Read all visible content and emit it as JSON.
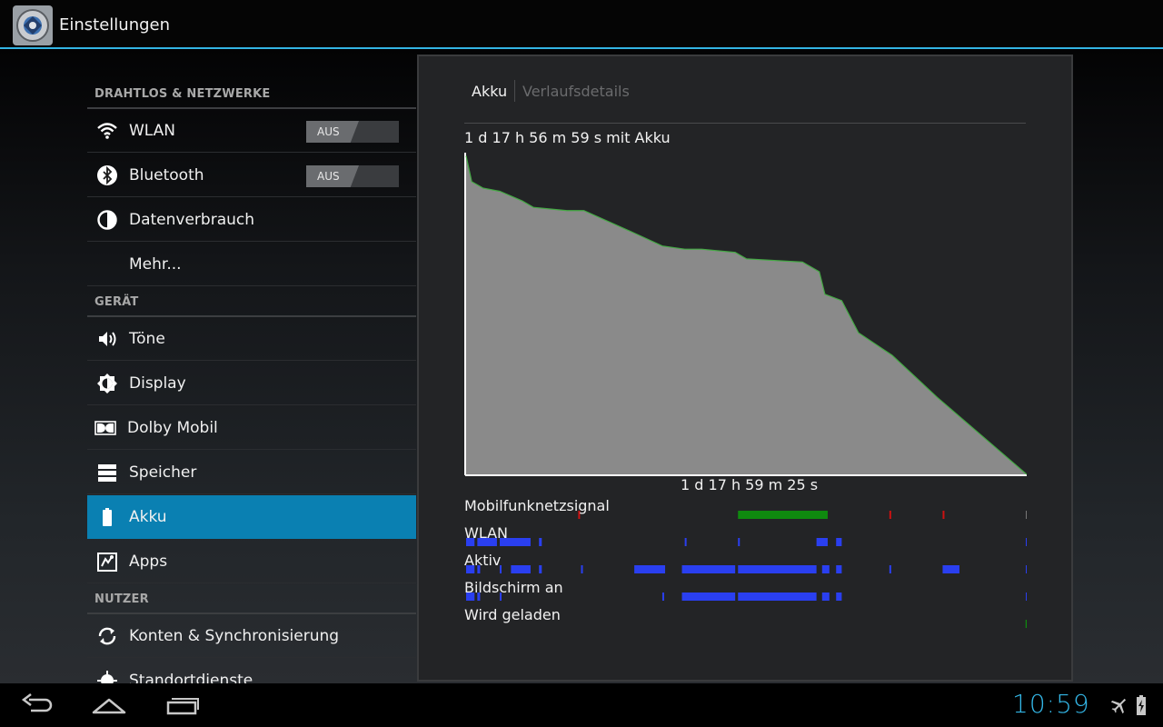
{
  "app": {
    "title": "Einstellungen",
    "icon": "settings-gear-icon"
  },
  "sidebar": {
    "categories": {
      "wireless": "DRAHTLOS & NETZWERKE",
      "device": "GERÄT",
      "users": "NUTZER"
    },
    "items": {
      "wlan": {
        "label": "WLAN",
        "icon": "wifi-icon",
        "toggle": "AUS"
      },
      "bluetooth": {
        "label": "Bluetooth",
        "icon": "bluetooth-icon",
        "toggle": "AUS"
      },
      "data_usage": {
        "label": "Datenverbrauch",
        "icon": "data-usage-icon"
      },
      "more": {
        "label": "Mehr..."
      },
      "sound": {
        "label": "Töne",
        "icon": "speaker-icon"
      },
      "display": {
        "label": "Display",
        "icon": "brightness-icon"
      },
      "dolby": {
        "label": "Dolby Mobil",
        "icon": "dolby-icon"
      },
      "storage": {
        "label": "Speicher",
        "icon": "storage-icon"
      },
      "battery": {
        "label": "Akku",
        "icon": "battery-icon",
        "selected": true
      },
      "apps": {
        "label": "Apps",
        "icon": "apps-icon"
      },
      "accounts": {
        "label": "Konten & Synchronisierung",
        "icon": "sync-icon"
      },
      "location": {
        "label": "Standortdienste",
        "icon": "location-icon"
      }
    }
  },
  "battery_panel": {
    "tabs": {
      "active": "Akku",
      "inactive": "Verlaufsdetails"
    },
    "on_battery": "1 d 17 h 56 m 59 s mit Akku",
    "time_on_battery": "1 d 17 h 59 m 25 s",
    "signals": {
      "mobile": "Mobilfunknetzsignal",
      "wlan": "WLAN",
      "awake": "Aktiv",
      "screen_on": "Bildschirm an",
      "charging": "Wird geladen"
    },
    "colors": {
      "fill": "#8a8a8a",
      "edge": "#44aa44",
      "bars": "#2a3ff0",
      "signal_good": "#0f8a0f",
      "signal_bad": "#cc1111"
    }
  },
  "chart_data": {
    "type": "area",
    "title": "",
    "xlabel": "1 d 17 h 59 m 25 s",
    "ylabel": "",
    "x_unit": "fraction of time on battery",
    "y_unit": "battery level %",
    "ylim": [
      0,
      100
    ],
    "x": [
      0,
      0.01,
      0.03,
      0.06,
      0.1,
      0.12,
      0.18,
      0.21,
      0.3,
      0.35,
      0.39,
      0.42,
      0.48,
      0.5,
      0.6,
      0.63,
      0.64,
      0.67,
      0.7,
      0.76,
      0.84,
      1.0
    ],
    "y": [
      99,
      91,
      89,
      88,
      85,
      83,
      82,
      82,
      75,
      71,
      70,
      70,
      69,
      67,
      66,
      63,
      56,
      54,
      44,
      37,
      24,
      0
    ]
  },
  "signal_bars": {
    "mobile": {
      "good": [
        [
          0.485,
          0.645
        ]
      ],
      "bad": [
        0.2,
        0.755,
        0.85
      ]
    },
    "wlan": [
      [
        0.0,
        0.015
      ],
      [
        0.02,
        0.055
      ],
      [
        0.06,
        0.115
      ],
      [
        0.13,
        0.135
      ],
      [
        0.39,
        0.392
      ],
      [
        0.485,
        0.487
      ],
      [
        0.625,
        0.645
      ],
      [
        0.66,
        0.67
      ]
    ],
    "awake": [
      [
        0.0,
        0.015
      ],
      [
        0.02,
        0.025
      ],
      [
        0.06,
        0.062
      ],
      [
        0.08,
        0.115
      ],
      [
        0.13,
        0.135
      ],
      [
        0.205,
        0.207
      ],
      [
        0.3,
        0.355
      ],
      [
        0.385,
        0.48
      ],
      [
        0.485,
        0.625
      ],
      [
        0.635,
        0.648
      ],
      [
        0.66,
        0.67
      ],
      [
        0.755,
        0.757
      ],
      [
        0.85,
        0.88
      ]
    ],
    "screen_on": [
      [
        0.0,
        0.015
      ],
      [
        0.02,
        0.025
      ],
      [
        0.06,
        0.062
      ],
      [
        0.35,
        0.352
      ],
      [
        0.385,
        0.48
      ],
      [
        0.485,
        0.625
      ],
      [
        0.635,
        0.648
      ],
      [
        0.66,
        0.67
      ]
    ],
    "charging": [
      [
        0.998,
        1.0
      ]
    ]
  },
  "status": {
    "clock": "10:59"
  }
}
